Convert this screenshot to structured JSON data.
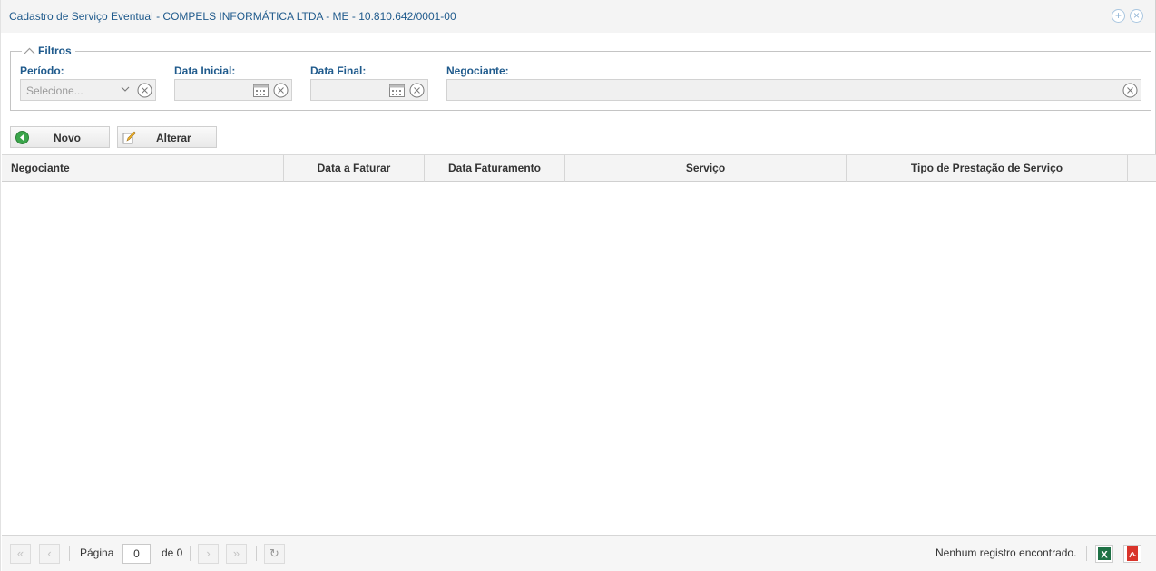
{
  "window": {
    "title": "Cadastro de Serviço Eventual - COMPELS INFORMÁTICA LTDA - ME - 10.810.642/0001-00",
    "maximize_icon": "plus-circle-icon",
    "close_icon": "close-circle-icon"
  },
  "filters": {
    "legend": "Filtros",
    "periodo": {
      "label": "Período:",
      "placeholder": "Selecione...",
      "value": ""
    },
    "data_inicial": {
      "label": "Data Inicial:",
      "value": ""
    },
    "data_final": {
      "label": "Data Final:",
      "value": ""
    },
    "negociante": {
      "label": "Negociante:",
      "value": ""
    }
  },
  "toolbar": {
    "novo_label": "Novo",
    "alterar_label": "Alterar"
  },
  "grid": {
    "columns": [
      "Negociante",
      "Data a Faturar",
      "Data Faturamento",
      "Serviço",
      "Tipo de Prestação de Serviço"
    ],
    "rows": []
  },
  "pager": {
    "page_label": "Página",
    "page_value": "0",
    "of_label": "de 0",
    "status": "Nenhum registro encontrado.",
    "export_excel_icon": "excel-icon",
    "export_pdf_icon": "pdf-icon"
  },
  "colors": {
    "accent": "#1f5a8c",
    "excel": "#1e7145",
    "pdf": "#d9342b",
    "novo_icon": "#3aa54a"
  }
}
